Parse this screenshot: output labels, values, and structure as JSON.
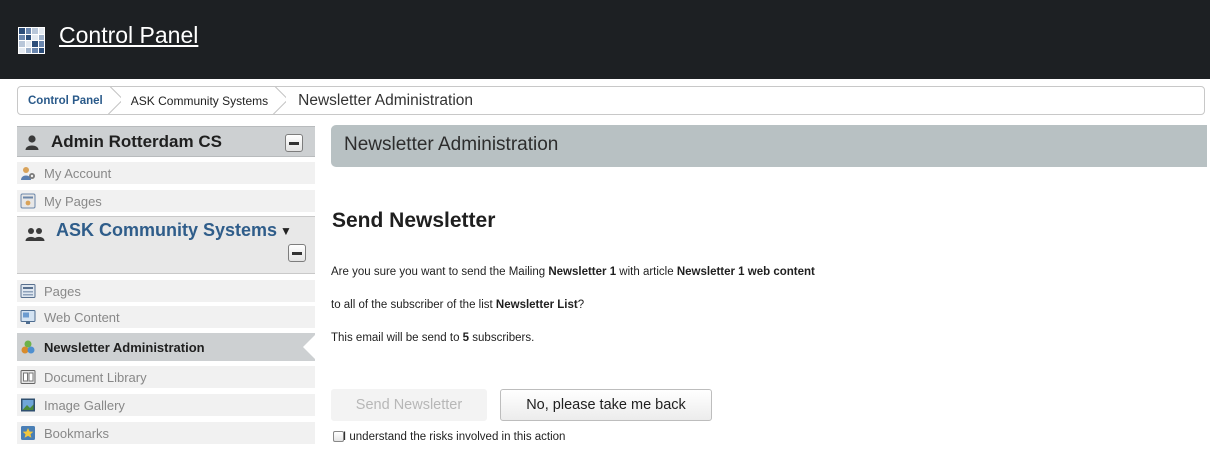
{
  "header": {
    "title": "Control Panel"
  },
  "breadcrumb": [
    "Control Panel",
    "ASK Community Systems",
    "Newsletter Administration"
  ],
  "sidebar": {
    "user_name": "Admin Rotterdam CS",
    "user_items": [
      "My Account",
      "My Pages"
    ],
    "site_name": "ASK Community Systems",
    "site_arrow": "▼",
    "site_items": [
      "Pages",
      "Web Content",
      "Newsletter Administration",
      "Document Library",
      "Image Gallery",
      "Bookmarks"
    ],
    "active_item": "Newsletter Administration"
  },
  "main": {
    "portlet_title": "Newsletter Administration",
    "heading": "Send Newsletter",
    "line1": {
      "prefix": "Are you sure you want to send the Mailing ",
      "mailing": "Newsletter 1",
      "middle": " with article ",
      "article": "Newsletter 1 web content"
    },
    "line2": {
      "prefix": "to all of the subscriber of the list ",
      "list": "Newsletter List",
      "suffix": "?"
    },
    "line3": {
      "prefix": "This email will be send to ",
      "count": "5",
      "suffix": " subscribers."
    },
    "send_button": "Send Newsletter",
    "back_button": "No, please take me back",
    "checkbox_label": "I understand the risks involved in this action",
    "checkbox_checked": false
  },
  "colors": {
    "topbar": "#1d2023",
    "site_link": "#2f5d8a",
    "portlet_header": "#b8c1c3"
  }
}
